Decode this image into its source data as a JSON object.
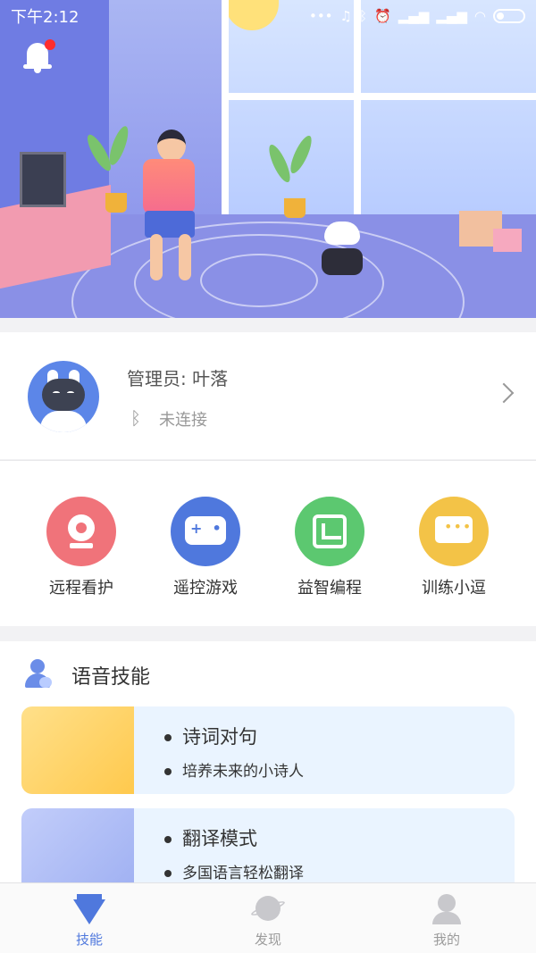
{
  "status_bar": {
    "time": "下午2:12",
    "icons": [
      "dots-icon",
      "headphones-icon",
      "bluetooth-icon",
      "alarm-icon",
      "signal-icon",
      "signal-icon",
      "wifi-icon",
      "battery-icon"
    ]
  },
  "hero": {
    "notification_icon": "bell-icon",
    "has_unread": true
  },
  "profile": {
    "admin_label": "管理员: 叶落",
    "connection_icon": "bluetooth-icon",
    "connection_status": "未连接"
  },
  "actions": [
    {
      "label": "远程看护",
      "color": "#f0737a",
      "icon": "camera-icon"
    },
    {
      "label": "遥控游戏",
      "color": "#4f78dd",
      "icon": "gamepad-icon"
    },
    {
      "label": "益智编程",
      "color": "#5cc870",
      "icon": "code-icon"
    },
    {
      "label": "训练小逗",
      "color": "#f3c347",
      "icon": "chat-icon"
    }
  ],
  "skills": {
    "title": "语音技能",
    "items": [
      {
        "name": "诗词对句",
        "desc": "培养未来的小诗人",
        "thumb_color": "#ffd36a"
      },
      {
        "name": "翻译模式",
        "desc": "多国语言轻松翻译",
        "thumb_color": "#aebcf6"
      }
    ]
  },
  "tabbar": {
    "active_color": "#4f78dd",
    "inactive_color": "#9b9b9b",
    "tabs": [
      {
        "label": "技能",
        "icon": "diamond-icon",
        "active": true
      },
      {
        "label": "发现",
        "icon": "planet-icon",
        "active": false
      },
      {
        "label": "我的",
        "icon": "profile-icon",
        "active": false
      }
    ]
  }
}
